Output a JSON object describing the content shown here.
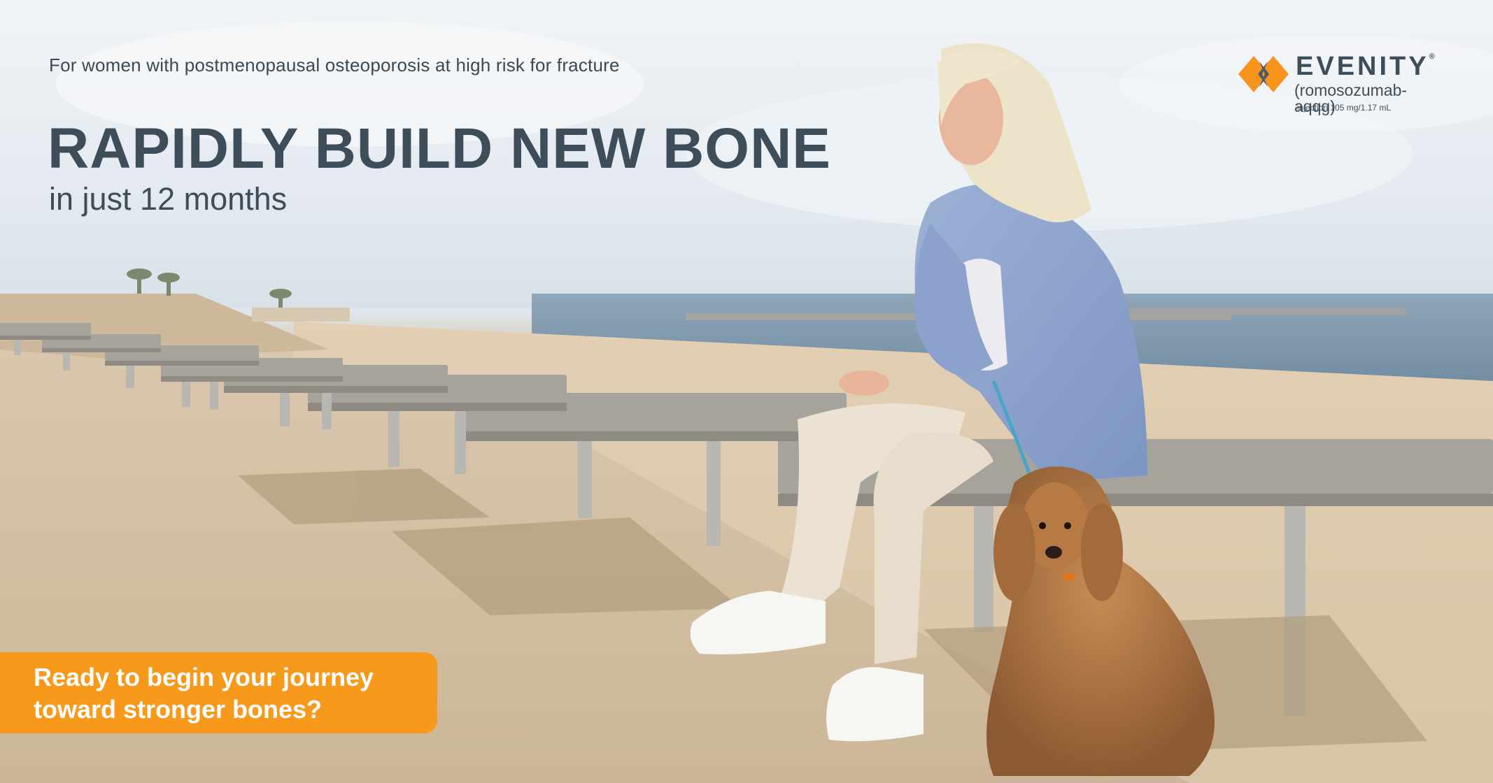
{
  "eyebrow": "For women with postmenopausal osteoporosis at high risk for fracture",
  "headline": "RAPIDLY BUILD NEW BONE",
  "subheadline": "in just 12 months",
  "brand": {
    "name": "EVENITY",
    "registered_mark": "®",
    "generic_name": "(romosozumab-aqqg)",
    "dose_text": "injection 105 mg/1.17 mL"
  },
  "cta": {
    "line1": "Ready to begin your journey",
    "line2": "toward stronger bones?"
  },
  "colors": {
    "headline_text": "#3d4d5a",
    "cta_background": "#f79a1c",
    "cta_text": "#ffffff",
    "logo_orange": "#f7941d",
    "logo_slate": "#4a5a68"
  },
  "icons": {
    "logo_mark": "evenity-logo-icon"
  }
}
